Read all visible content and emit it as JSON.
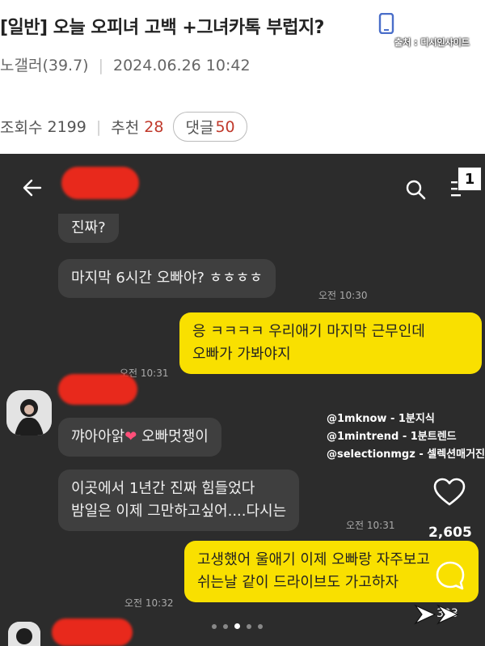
{
  "post": {
    "title": "[일반] 오늘 오피녀 고백 +그녀카톡 부럽지?",
    "source_tag": "출처 : 디시인사이드",
    "author": "노갤러(39.7)",
    "datetime": "2024.06.26 10:42",
    "views_label": "조회수",
    "views": "2199",
    "recommend_label": "추천",
    "recommend": "28",
    "comments_label": "댓글",
    "comments": "50"
  },
  "chat": {
    "page_badge": "1",
    "messages": [
      {
        "dir": "in",
        "text": "진짜?"
      },
      {
        "dir": "in",
        "text": "마지막 6시간 오빠야? ㅎㅎㅎㅎ",
        "time": "오전 10:30"
      },
      {
        "dir": "out",
        "line1": "응 ㅋㅋㅋㅋ 우리애기 마지막 근무인데",
        "line2": "오빠가 가봐야지",
        "time": "오전 10:31"
      },
      {
        "dir": "in",
        "text_before": "꺄아아앍",
        "emoji": "❤",
        "text_after": " 오빠멋쟁이"
      },
      {
        "dir": "in",
        "line1": "이곳에서 1년간 진짜 힘들었다",
        "line2": "밤일은 이제 그만하고싶어....다시는",
        "time": "오전 10:31"
      },
      {
        "dir": "out",
        "line1": "고생했어 울애기 이제 오빠랑 자주보고",
        "line2": "쉬는날 같이 드라이브도 가고하자",
        "time": "오전 10:32"
      }
    ]
  },
  "overlay": {
    "watermarks": [
      "@1mknow - 1분지식",
      "@1mintrend - 1분트렌드",
      "@selectionmgz - 셀렉션매거진"
    ],
    "likes": "2,605",
    "comments": "303"
  },
  "colors": {
    "chat_bg": "#2c2c2c",
    "bubble_in": "#3f3f3f",
    "bubble_out": "#f9e000",
    "redaction": "#e8291c",
    "accent_red": "#c0392b"
  }
}
